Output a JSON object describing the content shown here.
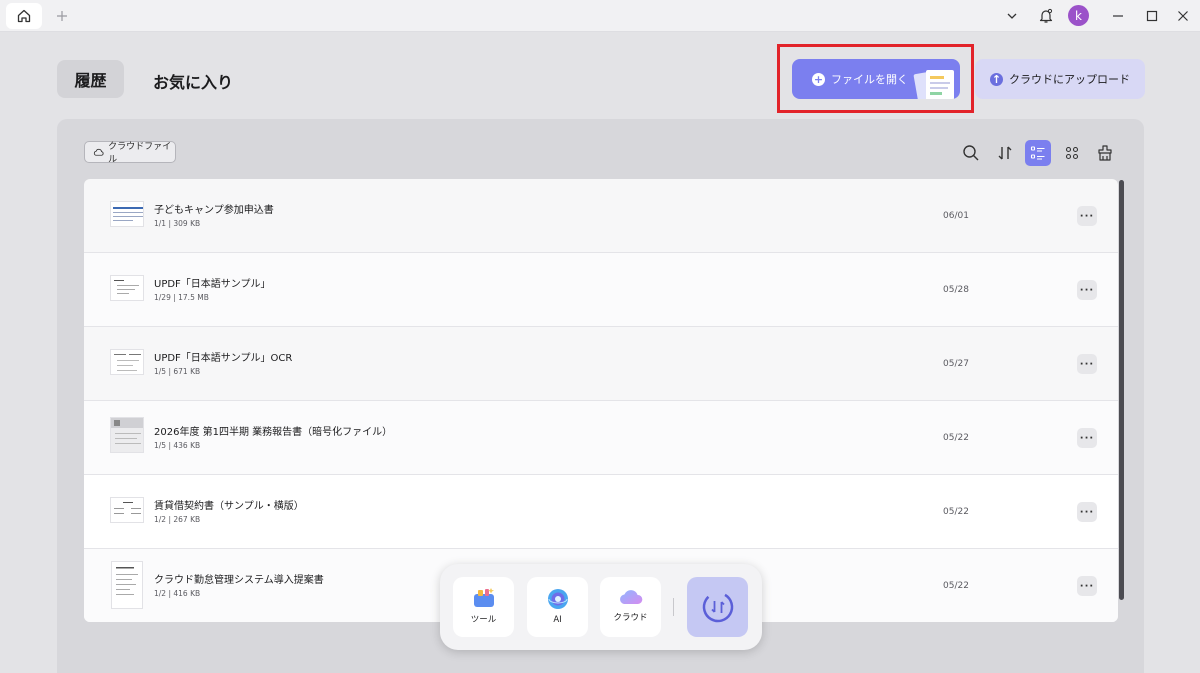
{
  "titlebar": {
    "home_tab": "home-icon",
    "add_tab": "+",
    "avatar_letter": "k"
  },
  "header": {
    "tab_history": "履歴",
    "tab_favorites": "お気に入り",
    "open_file_label": "ファイルを開く",
    "upload_cloud_label": "クラウドにアップロード"
  },
  "toolbar": {
    "cloud_files_label": "クラウドファイル"
  },
  "files": [
    {
      "name": "子どもキャンプ参加申込書",
      "meta": "1/1 | 309 KB",
      "date": "06/01"
    },
    {
      "name": "UPDF「日本語サンプル」",
      "meta": "1/29 | 17.5 MB",
      "date": "05/28"
    },
    {
      "name": "UPDF「日本語サンプル」OCR",
      "meta": "1/5 | 671 KB",
      "date": "05/27"
    },
    {
      "name": "2026年度 第1四半期 業務報告書（暗号化ファイル）",
      "meta": "1/5 | 436 KB",
      "date": "05/22"
    },
    {
      "name": "賃貸借契約書（サンプル・横版）",
      "meta": "1/2 | 267 KB",
      "date": "05/22"
    },
    {
      "name": "クラウド勤怠管理システム導入提案書",
      "meta": "1/2 | 416 KB",
      "date": "05/22"
    }
  ],
  "row_more_label": "···",
  "dock": {
    "tools_label": "ツール",
    "ai_label": "AI",
    "cloud_label": "クラウド"
  },
  "colors": {
    "accent": "#7b7fef",
    "highlight": "#e2232a",
    "avatar": "#9b52c9"
  }
}
